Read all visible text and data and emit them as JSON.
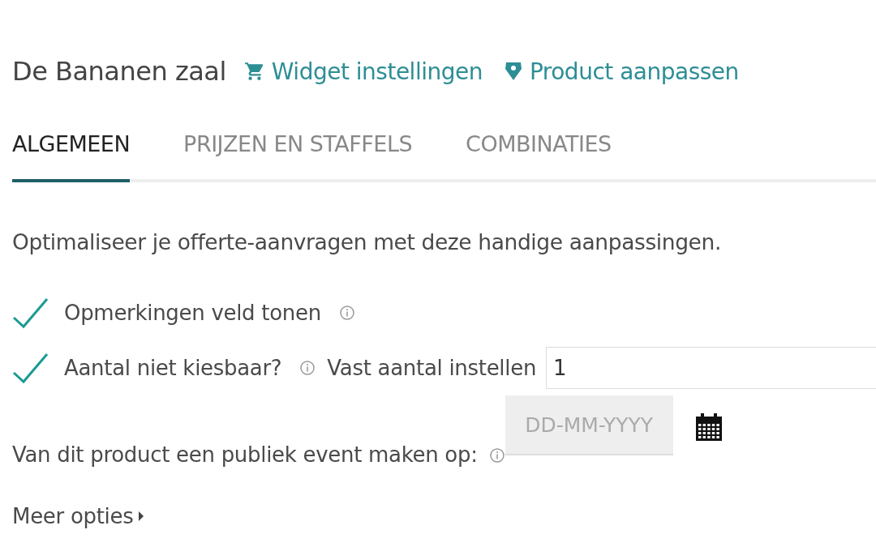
{
  "header": {
    "title": "De Bananen zaal",
    "links": [
      {
        "label": "Widget instellingen",
        "kind": "cart"
      },
      {
        "label": "Product aanpassen",
        "kind": "tag"
      }
    ]
  },
  "tabs": [
    {
      "label": "ALGEMEEN",
      "selected": true
    },
    {
      "label": "PRIJZEN EN STAFFELS",
      "selected": false
    },
    {
      "label": "COMBINATIES",
      "selected": false
    }
  ],
  "intro": "Optimaliseer je offerte-aanvragen met deze handige aanpassingen.",
  "options": [
    {
      "label": "Opmerkingen veld tonen",
      "checked": true
    },
    {
      "label": "Aantal niet kiesbaar?",
      "checked": true,
      "field_label": "Vast aantal instellen",
      "value": "1"
    }
  ],
  "event": {
    "label": "Van dit product een publiek event maken op:",
    "placeholder": "DD-MM-YYYY"
  },
  "more": {
    "label": "Meer opties"
  }
}
